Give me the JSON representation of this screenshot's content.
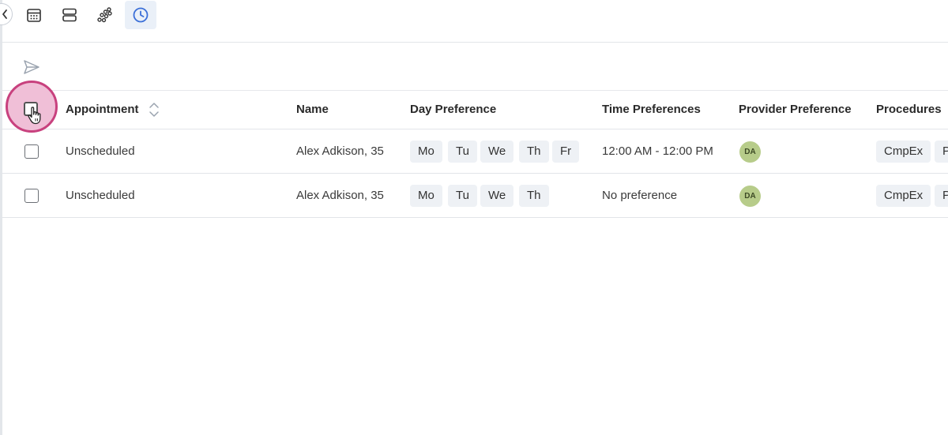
{
  "toolbar": {
    "tools": [
      {
        "icon": "calendar-icon",
        "active": false
      },
      {
        "icon": "rows-icon",
        "active": false
      },
      {
        "icon": "dots-cluster-icon",
        "active": false
      },
      {
        "icon": "clock-icon",
        "active": true
      }
    ]
  },
  "actions": {
    "send_icon": "send-icon"
  },
  "table": {
    "columns": [
      {
        "key": "appointment",
        "label": "Appointment",
        "sortable": true
      },
      {
        "key": "name",
        "label": "Name"
      },
      {
        "key": "day",
        "label": "Day Preference"
      },
      {
        "key": "time",
        "label": "Time Preferences"
      },
      {
        "key": "provider",
        "label": "Provider Preference"
      },
      {
        "key": "procedures",
        "label": "Procedures"
      }
    ],
    "rows": [
      {
        "appointment": "Unscheduled",
        "name": "Alex Adkison, 35",
        "days": [
          "Mo",
          "Tu",
          "We",
          "Th",
          "Fr"
        ],
        "time": "12:00 AM - 12:00 PM",
        "provider_initials": "DA",
        "procedures": [
          "CmpEx",
          "P"
        ]
      },
      {
        "appointment": "Unscheduled",
        "name": "Alex Adkison, 35",
        "days": [
          "Mo",
          "Tu",
          "We",
          "Th"
        ],
        "time": "No preference",
        "provider_initials": "DA",
        "procedures": [
          "CmpEx",
          "P"
        ]
      }
    ]
  },
  "colors": {
    "accent": "#3b6fd8",
    "highlight_ring": "#c8417e",
    "highlight_fill": "#f0bfd7",
    "chip_bg": "#eef1f5",
    "avatar_bg": "#b7cc8a"
  }
}
